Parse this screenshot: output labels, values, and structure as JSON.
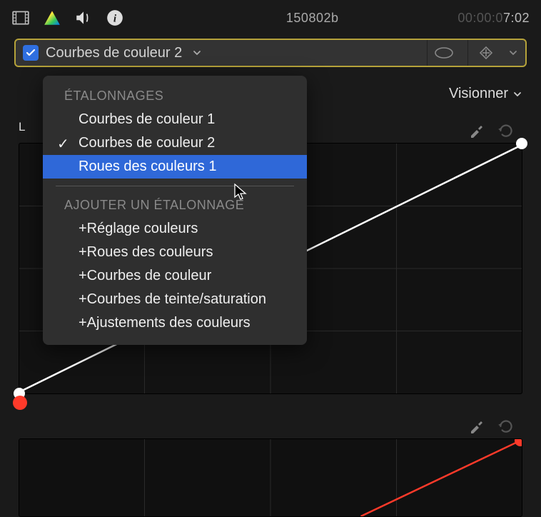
{
  "clip": {
    "name": "150802b"
  },
  "timecode": {
    "dim": "00:00:0",
    "bright": "7:02"
  },
  "effect_bar": {
    "name": "Courbes de couleur 2",
    "checked": true
  },
  "view_button": {
    "label": "Visionner"
  },
  "luma_label": "L",
  "dropdown": {
    "section1_header": "ÉTALONNAGES",
    "items": [
      {
        "label": "Courbes de couleur 1",
        "checked": false,
        "highlight": false
      },
      {
        "label": "Courbes de couleur 2",
        "checked": true,
        "highlight": false
      },
      {
        "label": "Roues des couleurs 1",
        "checked": false,
        "highlight": true
      }
    ],
    "section2_header": "AJOUTER UN ÉTALONNAGE",
    "add_items": [
      {
        "label": "+Réglage couleurs"
      },
      {
        "label": "+Roues des couleurs"
      },
      {
        "label": "+Courbes de couleur"
      },
      {
        "label": "+Courbes de teinte/saturation"
      },
      {
        "label": "+Ajustements des couleurs"
      }
    ]
  },
  "icons": {
    "film": "film-icon",
    "color": "color-icon",
    "volume": "volume-icon",
    "info": "info-icon",
    "mask": "mask-icon",
    "keyframe": "keyframe-icon",
    "caret": "chevron-down-icon",
    "eyedropper": "eyedropper-icon",
    "undo": "undo-icon"
  }
}
